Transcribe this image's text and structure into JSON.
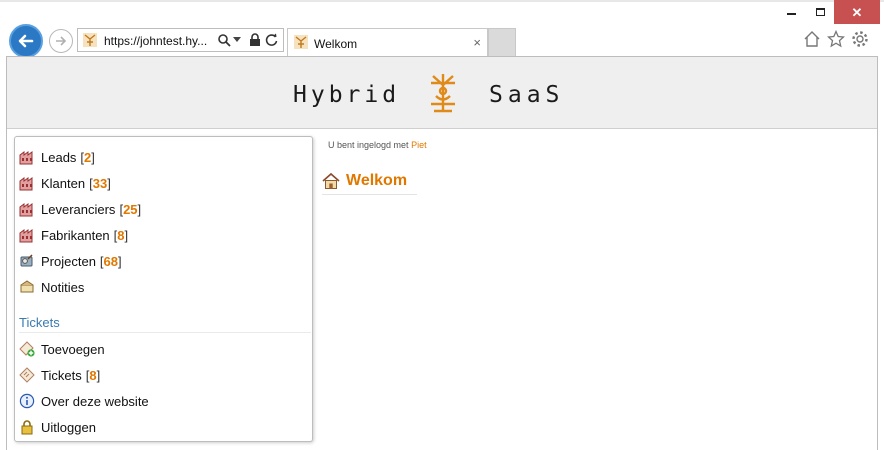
{
  "browser": {
    "url": "https://johntest.hy...",
    "tab_title": "Welkom",
    "tab_close": "×",
    "close_glyph": "✕",
    "accent": "#2b79c5"
  },
  "header": {
    "logo_left": "Hybrid",
    "logo_right": "SaaS"
  },
  "sidebar": {
    "items": [
      {
        "label": "Leads",
        "count": "2",
        "icon": "factory-icon"
      },
      {
        "label": "Klanten",
        "count": "33",
        "icon": "factory-icon"
      },
      {
        "label": "Leveranciers",
        "count": "25",
        "icon": "factory-icon"
      },
      {
        "label": "Fabrikanten",
        "count": "8",
        "icon": "factory-icon"
      },
      {
        "label": "Projecten",
        "count": "68",
        "icon": "project-icon"
      },
      {
        "label": "Notities",
        "count": "",
        "icon": "notes-icon"
      }
    ],
    "tickets_title": "Tickets",
    "ticket_items": [
      {
        "label": "Toevoegen",
        "count": "",
        "icon": "ticket-add-icon"
      },
      {
        "label": "Tickets",
        "count": "8",
        "icon": "ticket-icon"
      },
      {
        "label": "Over deze website",
        "count": "",
        "icon": "info-icon"
      },
      {
        "label": "Uitloggen",
        "count": "",
        "icon": "lock-icon"
      }
    ]
  },
  "main": {
    "login_prefix": "U bent ingelogd met",
    "user": "Piet",
    "welcome_title": "Welkom"
  },
  "colors": {
    "orange": "#e07800",
    "section_blue": "#3a7bb0"
  }
}
